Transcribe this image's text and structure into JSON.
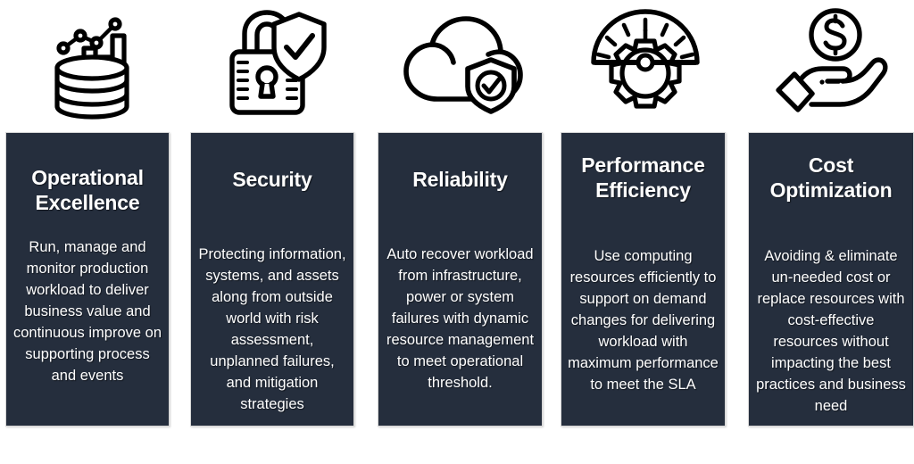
{
  "diagram": {
    "background_color": "#ffffff",
    "card_color": "#252E3D",
    "text_color": "#ffffff",
    "icon_color": "#000000"
  },
  "pillars": [
    {
      "icon_name": "database-analytics-icon",
      "title": "Operational Excellence",
      "body": "Run, manage and monitor production workload to deliver business value and continuous improve on supporting process and events"
    },
    {
      "icon_name": "padlock-shield-check-icon",
      "title": "Security",
      "body": "Protecting information, systems, and assets along from outside world with risk assessment, unplanned failures, and mitigation strategies"
    },
    {
      "icon_name": "cloud-shield-check-icon",
      "title": "Reliability",
      "body": "Auto recover workload from infrastructure, power or system failures with dynamic resource management to meet operational threshold."
    },
    {
      "icon_name": "speedometer-gear-icon",
      "title": "Performance Efficiency",
      "body": "Use computing resources efficiently to support on demand changes for delivering workload with maximum performance to meet the SLA"
    },
    {
      "icon_name": "hand-holding-coin-icon",
      "title": "Cost Optimization",
      "body": "Avoiding & eliminate un-needed  cost or replace resources with cost-effective resources without impacting the best practices and business need"
    }
  ]
}
